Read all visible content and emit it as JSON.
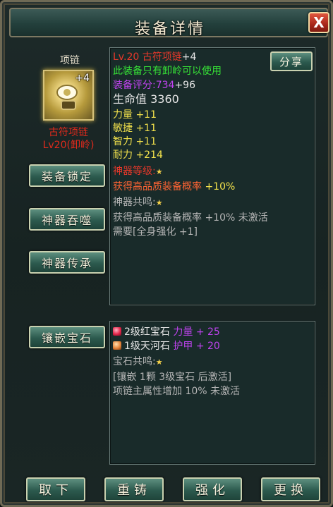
{
  "window": {
    "title": "装备详情",
    "close_label": "X"
  },
  "item": {
    "type": "项链",
    "level_badge": "+4",
    "name": "古符项链",
    "level_class": "Lv20(卸岭)"
  },
  "side_buttons": [
    "装备锁定",
    "神器吞噬",
    "神器传承",
    "镶嵌宝石"
  ],
  "share_label": "分享",
  "details": {
    "header_level": "Lv.20 古符项链",
    "header_plus": "+4",
    "restriction": "此装备只有卸岭可以使用",
    "score_label": "装备评分:",
    "score_value": "734",
    "score_bonus": "+96",
    "hp": "生命值 3360",
    "stats": [
      "力量 +11",
      "敏捷 +11",
      "智力 +11",
      "耐力 +214"
    ],
    "artifact_level_label": "神器等级:",
    "artifact_bonus_label": "获得高品质装备概率",
    "artifact_bonus_value": "+10%",
    "resonance_label": "神器共鸣:",
    "resonance_desc": "获得高品质装备概率 +10% 未激活",
    "resonance_req": "需要[全身强化 +1]"
  },
  "gems": {
    "items": [
      {
        "name": "2级红宝石",
        "stat": "力量 + 25",
        "icon": "red-gem-icon"
      },
      {
        "name": "1级天河石",
        "stat": "护甲 + 20",
        "icon": "river-stone-icon"
      }
    ],
    "resonance_label": "宝石共鸣:",
    "resonance_req": "[镶嵌 1颗 3级宝石 后激活]",
    "resonance_desc": "项链主属性增加 10% 未激活"
  },
  "bottom_buttons": [
    "取下",
    "重铸",
    "强化",
    "更换"
  ],
  "colors": {
    "accent_red": "#e8382a",
    "stat_yellow": "#f3e24c",
    "score_purple": "#c043f0",
    "restriction_green": "#36e236"
  }
}
